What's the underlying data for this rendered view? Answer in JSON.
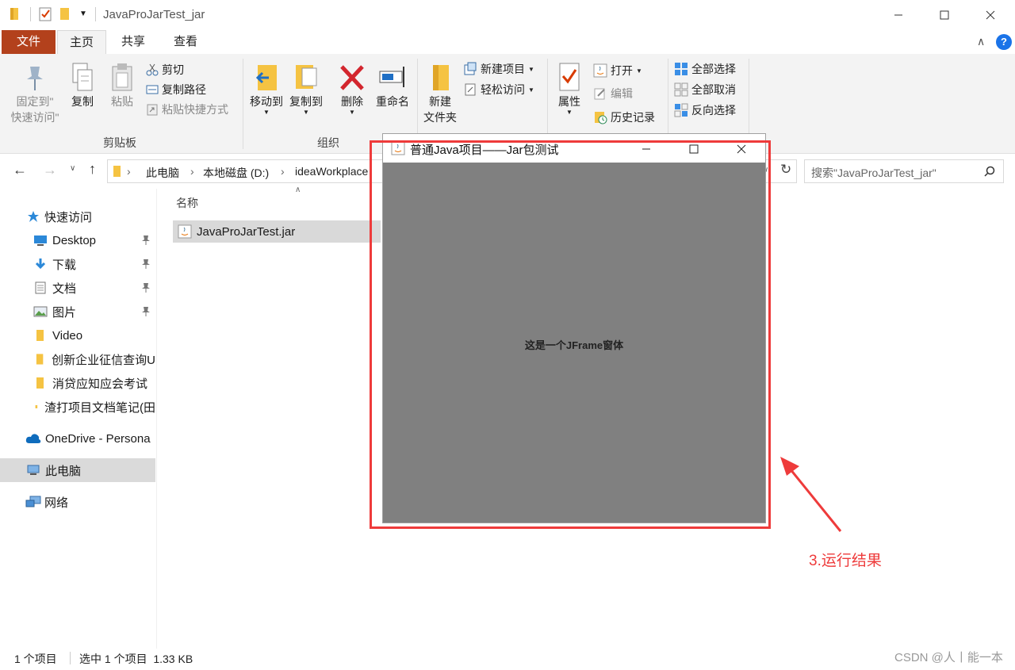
{
  "window": {
    "title": "JavaProJarTest_jar"
  },
  "tabs": [
    "文件",
    "主页",
    "共享",
    "查看"
  ],
  "ribbon": {
    "clipboard": {
      "pin_label_1": "固定到\"",
      "pin_label_2": "快速访问\"",
      "copy": "复制",
      "paste": "粘贴",
      "cut": "剪切",
      "copy_path": "复制路径",
      "paste_shortcut": "粘贴快捷方式",
      "group": "剪贴板"
    },
    "organize": {
      "move_to": "移动到",
      "copy_to": "复制到",
      "delete": "删除",
      "rename": "重命名",
      "group": "组织"
    },
    "new": {
      "new_folder_1": "新建",
      "new_folder_2": "文件夹",
      "new_item": "新建项目",
      "easy_access": "轻松访问"
    },
    "open": {
      "properties": "属性",
      "open": "打开",
      "edit": "编辑",
      "history": "历史记录"
    },
    "select": {
      "select_all": "全部选择",
      "select_none": "全部取消",
      "invert": "反向选择"
    }
  },
  "address": {
    "crumbs": [
      "此电脑",
      "本地磁盘 (D:)",
      "ideaWorkplace"
    ],
    "search_placeholder": "搜索\"JavaProJarTest_jar\""
  },
  "sidebar": {
    "items": [
      {
        "label": "快速访问",
        "icon": "star-icon"
      },
      {
        "label": "Desktop",
        "icon": "desktop-icon"
      },
      {
        "label": "下载",
        "icon": "download-icon"
      },
      {
        "label": "文档",
        "icon": "document-icon"
      },
      {
        "label": "图片",
        "icon": "picture-icon"
      },
      {
        "label": "Video",
        "icon": "folder-icon"
      },
      {
        "label": "创新企业征信查询U",
        "icon": "folder-icon"
      },
      {
        "label": "消贷应知应会考试",
        "icon": "folder-icon"
      },
      {
        "label": "渣打项目文档笔记(田",
        "icon": "folder-icon"
      },
      {
        "label": "OneDrive - Persona",
        "icon": "cloud-icon"
      },
      {
        "label": "此电脑",
        "icon": "pc-icon"
      },
      {
        "label": "网络",
        "icon": "network-icon"
      }
    ]
  },
  "filelist": {
    "column_name": "名称",
    "files": [
      {
        "name": "JavaProJarTest.jar"
      }
    ]
  },
  "status": {
    "count": "1 个项目",
    "selected": "选中 1 个项目  1.33 KB"
  },
  "jframe": {
    "title": "普通Java项目——Jar包测试",
    "label": "这是一个JFrame窗体"
  },
  "annotation": "3.运行结果",
  "watermark": "CSDN @人丨能一本",
  "colors": {
    "file_tab": "#b3411c",
    "annotation_red": "#ee3b3b",
    "jframe_bg": "#808080"
  }
}
